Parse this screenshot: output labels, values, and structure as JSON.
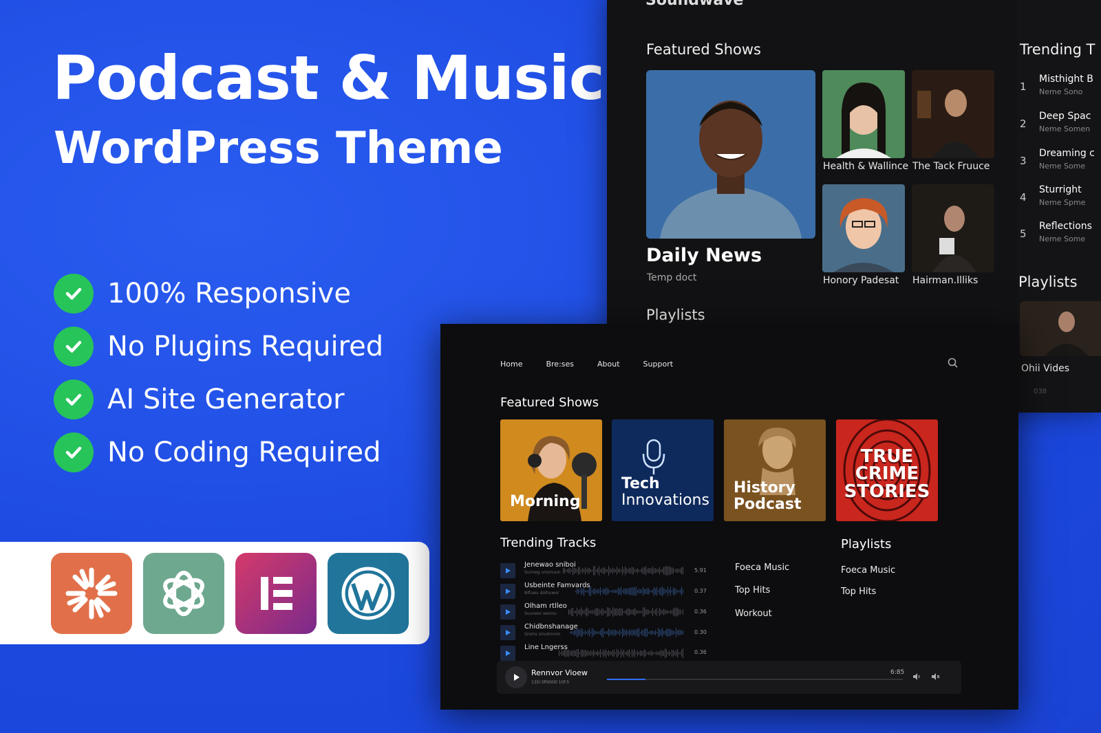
{
  "hero": {
    "title": "Podcast & Music",
    "subtitle": "WordPress Theme"
  },
  "features": [
    {
      "label": "100% Responsive"
    },
    {
      "label": "No Plugins Required"
    },
    {
      "label": "AI Site Generator"
    },
    {
      "label": "No Coding Required"
    }
  ],
  "logos": [
    {
      "icon": "sparkle-icon",
      "color": "#e1704a"
    },
    {
      "icon": "openai-icon",
      "color": "#6ea88f"
    },
    {
      "icon": "elementor-icon",
      "color": "#9b2a72"
    },
    {
      "icon": "wordpress-icon",
      "color": "#21759b"
    }
  ],
  "back_window": {
    "brand": "Soundwave",
    "featured_heading": "Featured Shows",
    "hero_title": "Daily News",
    "hero_sub": "Temp doct",
    "tiles": [
      {
        "caption": "Health & Wallince"
      },
      {
        "caption": "The Tack Fruuce"
      },
      {
        "caption": "Honory Padesat"
      },
      {
        "caption": "Hairman.Illiks"
      }
    ],
    "playlists_heading": "Playlists",
    "trending_heading": "Trending T",
    "trending": [
      {
        "num": "1",
        "title": "Misthight B",
        "sub": "Neme Sono"
      },
      {
        "num": "2",
        "title": "Deep Spac",
        "sub": "Neme Somen"
      },
      {
        "num": "3",
        "title": "Dreaming c",
        "sub": "Neme Some"
      },
      {
        "num": "4",
        "title": "Sturright",
        "sub": "Neme Spme"
      },
      {
        "num": "5",
        "title": "Reflections",
        "sub": "Neme Some"
      }
    ],
    "side_playlists_heading": "Playlists",
    "side_video_caption": "Ohii Vides",
    "side_video_meta": "038"
  },
  "front_window": {
    "nav": [
      {
        "label": "Home"
      },
      {
        "label": "Bre:ses"
      },
      {
        "label": "About"
      },
      {
        "label": "Support"
      }
    ],
    "featured_heading": "Featured Shows",
    "shows": [
      {
        "line1": "Morning",
        "line2": "",
        "color": "#d08a1e"
      },
      {
        "line1": "Tech",
        "line2": "Innovations",
        "color": "#0e2a5c"
      },
      {
        "line1": "History",
        "line2": "Podcast",
        "color": "#7a5220"
      },
      {
        "line1": "TRUE",
        "line2": "CRIME",
        "line3": "STORIES",
        "color": "#c9261e"
      }
    ],
    "trending_heading": "Trending Tracks",
    "tracks": [
      {
        "name": "Jenewao sniboi",
        "meta": "Sunneg unsmuun",
        "dur": "5.91"
      },
      {
        "name": "Usbeinte Famvards",
        "meta": "Nlfuwu dolhuwor",
        "dur": "0.37"
      },
      {
        "name": "Olham rtlleo",
        "meta": "Suuneor weimu",
        "dur": "0.36"
      },
      {
        "name": "Chidbnshanage",
        "meta": "Sroms sinulmrom",
        "dur": "0.30"
      },
      {
        "name": "Line Lngerss",
        "meta": "",
        "dur": "0.36"
      }
    ],
    "middle_list": [
      {
        "label": "Foeca Music"
      },
      {
        "label": "Top Hits"
      },
      {
        "label": "Workout"
      }
    ],
    "playlists_heading": "Playlists",
    "playlists": [
      {
        "label": "Foeca Music"
      },
      {
        "label": "Top Hits"
      }
    ],
    "player": {
      "title": "Rennvor Vioew",
      "meta": "135l 0f0000l 10f:5",
      "time": "6:85",
      "progress": 0.13
    }
  },
  "colors": {
    "background": "#1e4fe6",
    "check": "#27c45a",
    "accent": "#2f6ef5"
  }
}
